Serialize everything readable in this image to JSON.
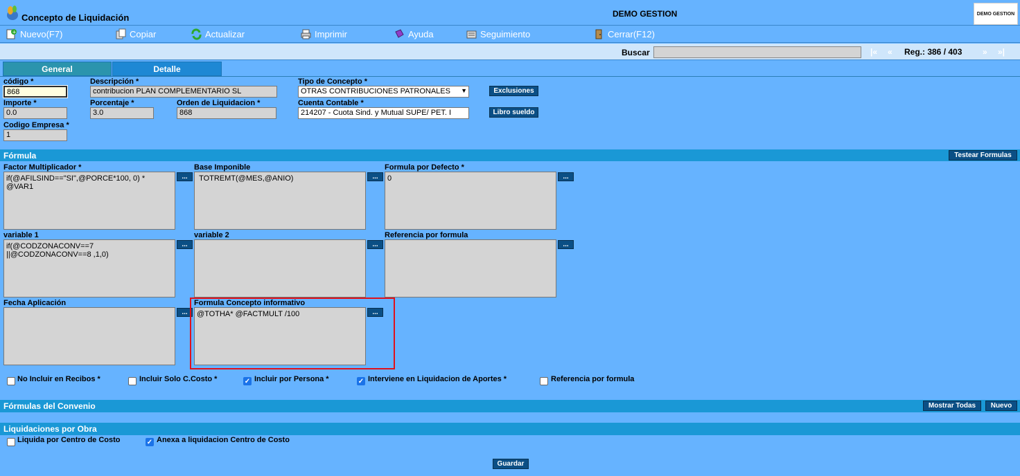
{
  "window": {
    "title": "Concepto de Liquidación",
    "company": "DEMO GESTION",
    "logo_text": "DEMO GESTION"
  },
  "toolbar": {
    "nuevo": "Nuevo(F7)",
    "copiar": "Copiar",
    "actualizar": "Actualizar",
    "imprimir": "Imprimir",
    "ayuda": "Ayuda",
    "seguimiento": "Seguimiento",
    "cerrar": "Cerrar(F12)"
  },
  "search": {
    "label": "Buscar",
    "value": ""
  },
  "pager": {
    "first": "|«",
    "prev": "«",
    "next": "»",
    "last": "»|",
    "reg": "Reg.: 386 / 403"
  },
  "tabs": [
    {
      "label": "General"
    },
    {
      "label": "Detalle"
    }
  ],
  "fields": {
    "codigo": {
      "label": "código *",
      "value": "868"
    },
    "descripcion": {
      "label": "Descripción *",
      "value": "contribucion PLAN COMPLEMENTARIO SL"
    },
    "tipo_concepto": {
      "label": "Tipo de Concepto *",
      "value": "OTRAS CONTRIBUCIONES PATRONALES"
    },
    "importe": {
      "label": "Importe *",
      "value": "0.0"
    },
    "porcentaje": {
      "label": "Porcentaje *",
      "value": "3.0"
    },
    "orden": {
      "label": "Orden de Liquidacion *",
      "value": "868"
    },
    "cuenta": {
      "label": "Cuenta Contable *",
      "value": "214207 - Cuota Sind. y Mutual SUPE/ PET. I"
    },
    "codigo_empresa": {
      "label": "Codigo Empresa *",
      "value": "1"
    }
  },
  "buttons": {
    "exclusiones": "Exclusiones",
    "libro_sueldo": "Libro sueldo",
    "testear": "Testear Formulas",
    "mostrar_todas": "Mostrar Todas",
    "nuevo": "Nuevo",
    "guardar": "Guardar",
    "dots": "..."
  },
  "formula": {
    "title": "Fórmula",
    "factor": {
      "label": "Factor Multiplicador *",
      "value": "if(@AFILSIND==\"SI\",@PORCE*100, 0) *\n@VAR1"
    },
    "base": {
      "label": "Base Imponible",
      "value": " TOTREMT(@MES,@ANIO)"
    },
    "defecto": {
      "label": "Formula por Defecto *",
      "value": "0"
    },
    "variable1": {
      "label": "variable 1",
      "value": "if(@CODZONACONV==7\n||@CODZONACONV==8 ,1,0)"
    },
    "variable2": {
      "label": "variable 2",
      "value": ""
    },
    "referencia": {
      "label": "Referencia por formula",
      "value": ""
    },
    "fecha": {
      "label": "Fecha Aplicación",
      "value": ""
    },
    "informativo": {
      "label": "Formula Concepto informativo",
      "value": "@TOTHA* @FACTMULT /100"
    }
  },
  "checks": {
    "no_incluir_recibos": {
      "label": "No Incluir en Recibos *",
      "checked": false
    },
    "incluir_solo_ccosto": {
      "label": "Incluir Solo C.Costo *",
      "checked": false
    },
    "incluir_persona": {
      "label": "Incluir por Persona *",
      "checked": true
    },
    "interviene_aportes": {
      "label": "Interviene en Liquidacion de Aportes *",
      "checked": true
    },
    "referencia_formula": {
      "label": "Referencia por formula",
      "checked": false
    },
    "liquida_ccosto": {
      "label": "Liquida por Centro de Costo",
      "checked": false
    },
    "anexa_ccosto": {
      "label": "Anexa a liquidacion Centro de Costo",
      "checked": true
    }
  },
  "sections": {
    "convenio": "Fórmulas del Convenio",
    "obra": "Liquidaciones por Obra"
  },
  "colors": {
    "background": "#66b3ff",
    "section": "#1a98d6",
    "button": "#0b4f85",
    "highlight": "#e0101a"
  }
}
